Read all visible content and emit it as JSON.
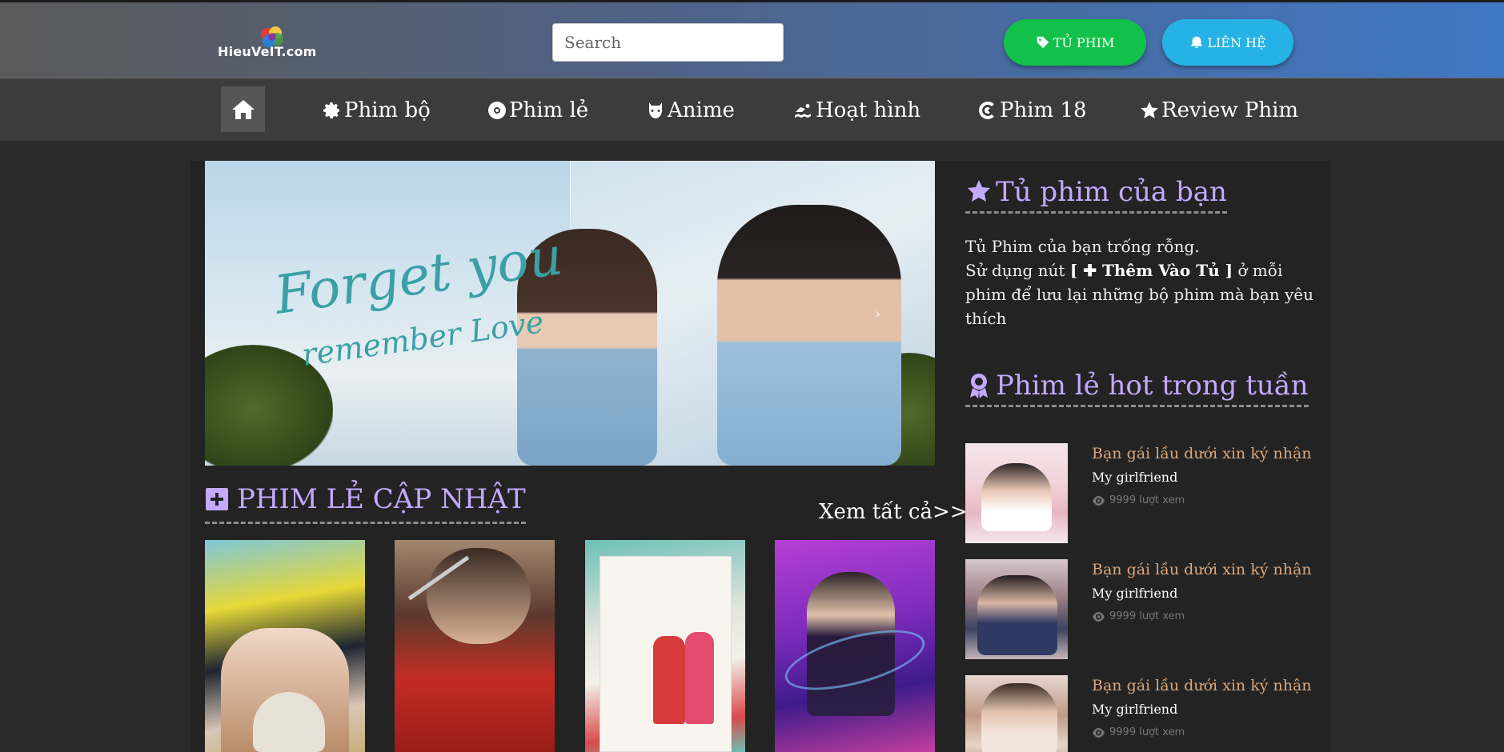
{
  "header": {
    "logo_text": "HieuVeIT.com",
    "search_placeholder": "Search",
    "btn_tu_phim": "TỦ PHIM",
    "btn_lien_he": "LIÊN HỆ"
  },
  "nav": {
    "items": [
      {
        "label": "Phim bộ",
        "icon": "gear-icon"
      },
      {
        "label": "Phim lẻ",
        "icon": "disc-icon"
      },
      {
        "label": "Anime",
        "icon": "mask-icon"
      },
      {
        "label": "Hoạt hình",
        "icon": "swimmer-icon"
      },
      {
        "label": "Phim 18",
        "icon": "censored-icon"
      },
      {
        "label": "Review Phim",
        "icon": "star-icon"
      }
    ]
  },
  "banner": {
    "line1": "Forget you",
    "line2": "remember Love"
  },
  "section": {
    "title": "PHIM LẺ CẬP NHẬT",
    "see_all": "Xem tất cả>>"
  },
  "sidebar": {
    "cabinet_title": "Tủ phim của bạn",
    "empty_line1": "Tủ Phim của bạn trống rỗng.",
    "empty_pre": "Sử dụng nút",
    "empty_btn": "[ ✚ Thêm Vào Tủ ]",
    "empty_post": "ở mỗi phim để lưu lại những bộ phim mà bạn yêu thích",
    "hot_title": "Phim lẻ hot trong tuần",
    "hot_items": [
      {
        "title": "Bạn gái lầu dưới xin ký nhận",
        "subtitle": "My girlfriend",
        "views": "9999 lượt xem"
      },
      {
        "title": "Bạn gái lầu dưới xin ký nhận",
        "subtitle": "My girlfriend",
        "views": "9999 lượt xem"
      },
      {
        "title": "Bạn gái lầu dưới xin ký nhận",
        "subtitle": "My girlfriend",
        "views": "9999 lượt xem"
      }
    ]
  },
  "colors": {
    "accent": "#c3a9ff",
    "btn_green": "#12c14a",
    "btn_blue": "#27b2e6",
    "hot_title": "#d9a67a"
  }
}
